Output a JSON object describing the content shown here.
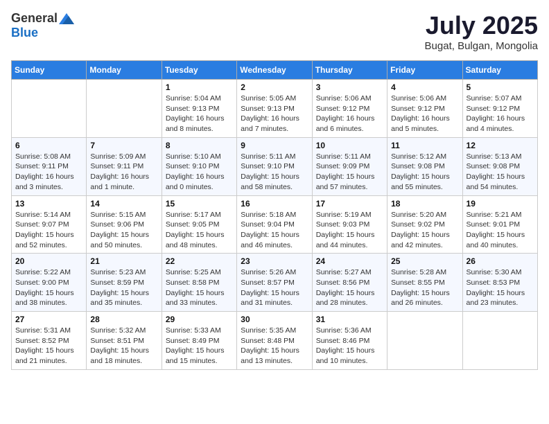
{
  "header": {
    "logo": {
      "general": "General",
      "blue": "Blue"
    },
    "title": "July 2025",
    "location": "Bugat, Bulgan, Mongolia"
  },
  "calendar": {
    "headers": [
      "Sunday",
      "Monday",
      "Tuesday",
      "Wednesday",
      "Thursday",
      "Friday",
      "Saturday"
    ],
    "weeks": [
      [
        {
          "day": "",
          "info": ""
        },
        {
          "day": "",
          "info": ""
        },
        {
          "day": "1",
          "info": "Sunrise: 5:04 AM\nSunset: 9:13 PM\nDaylight: 16 hours and 8 minutes."
        },
        {
          "day": "2",
          "info": "Sunrise: 5:05 AM\nSunset: 9:13 PM\nDaylight: 16 hours and 7 minutes."
        },
        {
          "day": "3",
          "info": "Sunrise: 5:06 AM\nSunset: 9:12 PM\nDaylight: 16 hours and 6 minutes."
        },
        {
          "day": "4",
          "info": "Sunrise: 5:06 AM\nSunset: 9:12 PM\nDaylight: 16 hours and 5 minutes."
        },
        {
          "day": "5",
          "info": "Sunrise: 5:07 AM\nSunset: 9:12 PM\nDaylight: 16 hours and 4 minutes."
        }
      ],
      [
        {
          "day": "6",
          "info": "Sunrise: 5:08 AM\nSunset: 9:11 PM\nDaylight: 16 hours and 3 minutes."
        },
        {
          "day": "7",
          "info": "Sunrise: 5:09 AM\nSunset: 9:11 PM\nDaylight: 16 hours and 1 minute."
        },
        {
          "day": "8",
          "info": "Sunrise: 5:10 AM\nSunset: 9:10 PM\nDaylight: 16 hours and 0 minutes."
        },
        {
          "day": "9",
          "info": "Sunrise: 5:11 AM\nSunset: 9:10 PM\nDaylight: 15 hours and 58 minutes."
        },
        {
          "day": "10",
          "info": "Sunrise: 5:11 AM\nSunset: 9:09 PM\nDaylight: 15 hours and 57 minutes."
        },
        {
          "day": "11",
          "info": "Sunrise: 5:12 AM\nSunset: 9:08 PM\nDaylight: 15 hours and 55 minutes."
        },
        {
          "day": "12",
          "info": "Sunrise: 5:13 AM\nSunset: 9:08 PM\nDaylight: 15 hours and 54 minutes."
        }
      ],
      [
        {
          "day": "13",
          "info": "Sunrise: 5:14 AM\nSunset: 9:07 PM\nDaylight: 15 hours and 52 minutes."
        },
        {
          "day": "14",
          "info": "Sunrise: 5:15 AM\nSunset: 9:06 PM\nDaylight: 15 hours and 50 minutes."
        },
        {
          "day": "15",
          "info": "Sunrise: 5:17 AM\nSunset: 9:05 PM\nDaylight: 15 hours and 48 minutes."
        },
        {
          "day": "16",
          "info": "Sunrise: 5:18 AM\nSunset: 9:04 PM\nDaylight: 15 hours and 46 minutes."
        },
        {
          "day": "17",
          "info": "Sunrise: 5:19 AM\nSunset: 9:03 PM\nDaylight: 15 hours and 44 minutes."
        },
        {
          "day": "18",
          "info": "Sunrise: 5:20 AM\nSunset: 9:02 PM\nDaylight: 15 hours and 42 minutes."
        },
        {
          "day": "19",
          "info": "Sunrise: 5:21 AM\nSunset: 9:01 PM\nDaylight: 15 hours and 40 minutes."
        }
      ],
      [
        {
          "day": "20",
          "info": "Sunrise: 5:22 AM\nSunset: 9:00 PM\nDaylight: 15 hours and 38 minutes."
        },
        {
          "day": "21",
          "info": "Sunrise: 5:23 AM\nSunset: 8:59 PM\nDaylight: 15 hours and 35 minutes."
        },
        {
          "day": "22",
          "info": "Sunrise: 5:25 AM\nSunset: 8:58 PM\nDaylight: 15 hours and 33 minutes."
        },
        {
          "day": "23",
          "info": "Sunrise: 5:26 AM\nSunset: 8:57 PM\nDaylight: 15 hours and 31 minutes."
        },
        {
          "day": "24",
          "info": "Sunrise: 5:27 AM\nSunset: 8:56 PM\nDaylight: 15 hours and 28 minutes."
        },
        {
          "day": "25",
          "info": "Sunrise: 5:28 AM\nSunset: 8:55 PM\nDaylight: 15 hours and 26 minutes."
        },
        {
          "day": "26",
          "info": "Sunrise: 5:30 AM\nSunset: 8:53 PM\nDaylight: 15 hours and 23 minutes."
        }
      ],
      [
        {
          "day": "27",
          "info": "Sunrise: 5:31 AM\nSunset: 8:52 PM\nDaylight: 15 hours and 21 minutes."
        },
        {
          "day": "28",
          "info": "Sunrise: 5:32 AM\nSunset: 8:51 PM\nDaylight: 15 hours and 18 minutes."
        },
        {
          "day": "29",
          "info": "Sunrise: 5:33 AM\nSunset: 8:49 PM\nDaylight: 15 hours and 15 minutes."
        },
        {
          "day": "30",
          "info": "Sunrise: 5:35 AM\nSunset: 8:48 PM\nDaylight: 15 hours and 13 minutes."
        },
        {
          "day": "31",
          "info": "Sunrise: 5:36 AM\nSunset: 8:46 PM\nDaylight: 15 hours and 10 minutes."
        },
        {
          "day": "",
          "info": ""
        },
        {
          "day": "",
          "info": ""
        }
      ]
    ]
  }
}
